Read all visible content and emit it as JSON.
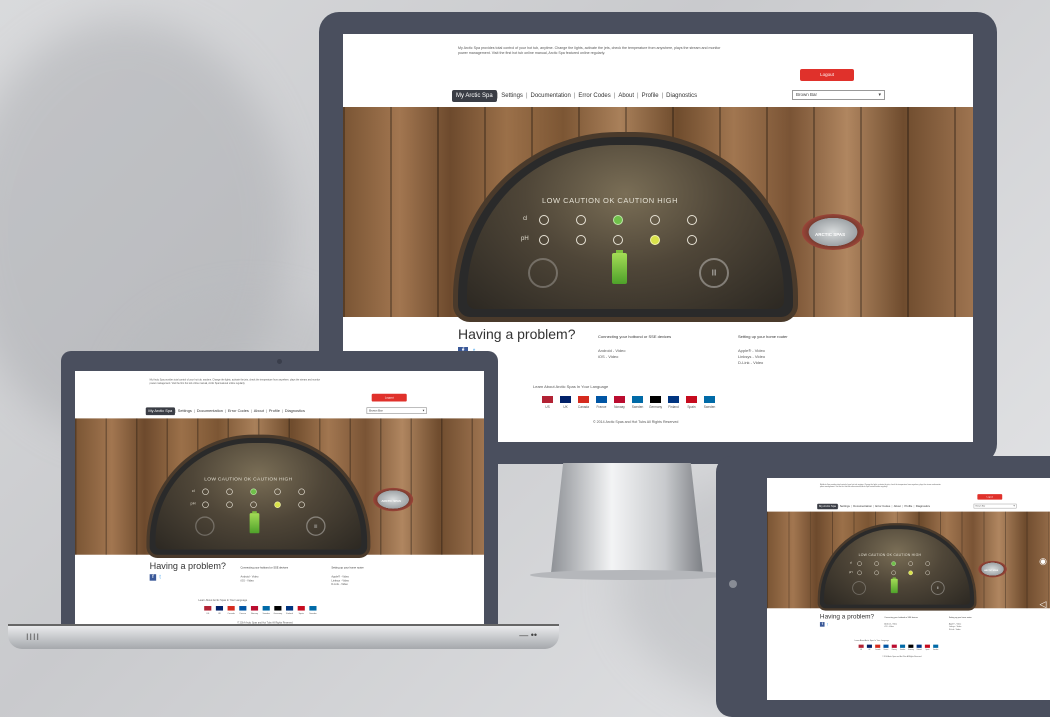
{
  "site": {
    "intro": "My Arctic Spa provides total control of your hot tub, anytime. Change the lights, activate the jets, check the temperature from anywhere, plays the stream and monitor power management. Visit the first hot tub online manual, Arctic Spa featured online regularly.",
    "logout_label": "Logout",
    "nav": [
      "My Arctic Spa",
      "Settings",
      "Documentation",
      "Error Codes",
      "About",
      "Profile",
      "Diagnostics"
    ],
    "select_value": "Brown Bar",
    "levels": "LOW CAUTION OK CAUTION HIGH",
    "row_labels": [
      "cl",
      "pH"
    ],
    "gauge_right": "|||",
    "brand": "ARCTIC SPAS",
    "problem_title": "Having a problem?",
    "facebook": "f",
    "twitter": "t",
    "col1": {
      "heading": "Connecting your hotbond or SSE devices",
      "lines": [
        "Android - Video",
        "iOS - Video"
      ]
    },
    "col2": {
      "heading": "Setting up your home router",
      "lines": [
        "Apple® - Video",
        "Linksys - Video",
        "D-Link - Video"
      ]
    },
    "languages_label": "Learn About Arctic Spas In Your Language",
    "flags": [
      {
        "name": "US",
        "color": "#b22234"
      },
      {
        "name": "UK",
        "color": "#012169"
      },
      {
        "name": "Canada",
        "color": "#d52b1e"
      },
      {
        "name": "France",
        "color": "#0055a4"
      },
      {
        "name": "Norway",
        "color": "#ba0c2f"
      },
      {
        "name": "Sweden",
        "color": "#006aa7"
      },
      {
        "name": "Germany",
        "color": "#000000"
      },
      {
        "name": "Finland",
        "color": "#003580"
      },
      {
        "name": "Spain",
        "color": "#c60b1e"
      },
      {
        "name": "Sweden",
        "color": "#006aa7"
      }
    ],
    "copyright": "© 2014 Arctic Spas and Hot Tubs All Rights Reserved"
  },
  "devices": {
    "laptop_grip": "IIII",
    "laptop_indicator": "— ••",
    "side_icons": [
      "◉",
      "◁",
      "("
    ]
  },
  "colors": {
    "frame": "#4a4f5e",
    "accent": "#e0312b",
    "active_tab": "#3a3d45"
  }
}
